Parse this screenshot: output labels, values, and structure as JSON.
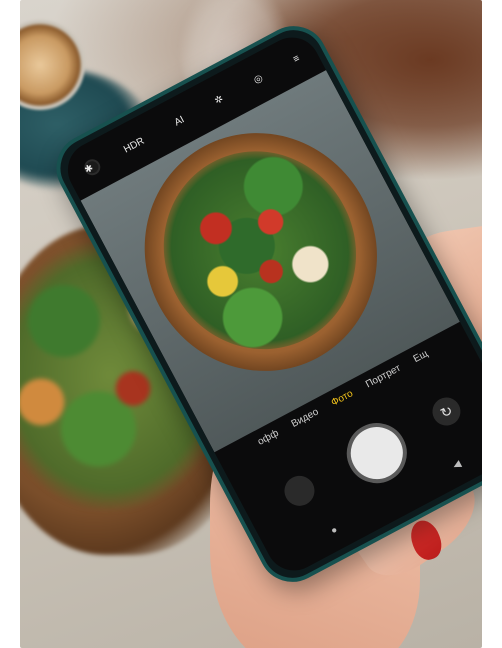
{
  "camera": {
    "status_icons": {
      "flash_icon": "✱",
      "hdr": "HDR",
      "ai": "AI",
      "effects_icon": "✲",
      "filter_icon": "◎",
      "menu_icon": "≡"
    },
    "modes": [
      "Видео",
      "Фото",
      "Портрет"
    ],
    "active_mode": "Фото",
    "partial_labels": {
      "left_cut": "офф",
      "right_cut": "Ещ"
    },
    "switch_icon": "↻",
    "nav": {
      "home_icon": "●",
      "back_icon": "◀"
    }
  },
  "colors": {
    "accent_active_mode": "#f2c21a",
    "phone_frame": "#17514f",
    "nail": "#d12a28"
  }
}
